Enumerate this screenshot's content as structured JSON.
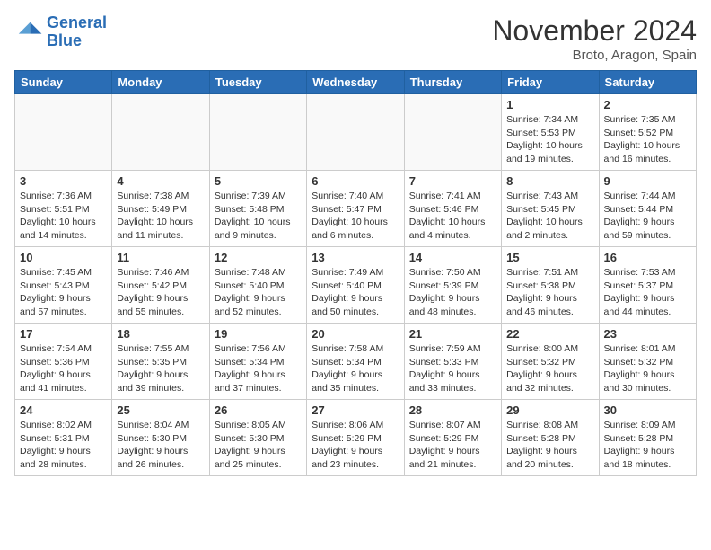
{
  "header": {
    "logo_line1": "General",
    "logo_line2": "Blue",
    "month": "November 2024",
    "location": "Broto, Aragon, Spain"
  },
  "weekdays": [
    "Sunday",
    "Monday",
    "Tuesday",
    "Wednesday",
    "Thursday",
    "Friday",
    "Saturday"
  ],
  "weeks": [
    [
      {
        "day": "",
        "info": ""
      },
      {
        "day": "",
        "info": ""
      },
      {
        "day": "",
        "info": ""
      },
      {
        "day": "",
        "info": ""
      },
      {
        "day": "",
        "info": ""
      },
      {
        "day": "1",
        "info": "Sunrise: 7:34 AM\nSunset: 5:53 PM\nDaylight: 10 hours\nand 19 minutes."
      },
      {
        "day": "2",
        "info": "Sunrise: 7:35 AM\nSunset: 5:52 PM\nDaylight: 10 hours\nand 16 minutes."
      }
    ],
    [
      {
        "day": "3",
        "info": "Sunrise: 7:36 AM\nSunset: 5:51 PM\nDaylight: 10 hours\nand 14 minutes."
      },
      {
        "day": "4",
        "info": "Sunrise: 7:38 AM\nSunset: 5:49 PM\nDaylight: 10 hours\nand 11 minutes."
      },
      {
        "day": "5",
        "info": "Sunrise: 7:39 AM\nSunset: 5:48 PM\nDaylight: 10 hours\nand 9 minutes."
      },
      {
        "day": "6",
        "info": "Sunrise: 7:40 AM\nSunset: 5:47 PM\nDaylight: 10 hours\nand 6 minutes."
      },
      {
        "day": "7",
        "info": "Sunrise: 7:41 AM\nSunset: 5:46 PM\nDaylight: 10 hours\nand 4 minutes."
      },
      {
        "day": "8",
        "info": "Sunrise: 7:43 AM\nSunset: 5:45 PM\nDaylight: 10 hours\nand 2 minutes."
      },
      {
        "day": "9",
        "info": "Sunrise: 7:44 AM\nSunset: 5:44 PM\nDaylight: 9 hours\nand 59 minutes."
      }
    ],
    [
      {
        "day": "10",
        "info": "Sunrise: 7:45 AM\nSunset: 5:43 PM\nDaylight: 9 hours\nand 57 minutes."
      },
      {
        "day": "11",
        "info": "Sunrise: 7:46 AM\nSunset: 5:42 PM\nDaylight: 9 hours\nand 55 minutes."
      },
      {
        "day": "12",
        "info": "Sunrise: 7:48 AM\nSunset: 5:40 PM\nDaylight: 9 hours\nand 52 minutes."
      },
      {
        "day": "13",
        "info": "Sunrise: 7:49 AM\nSunset: 5:40 PM\nDaylight: 9 hours\nand 50 minutes."
      },
      {
        "day": "14",
        "info": "Sunrise: 7:50 AM\nSunset: 5:39 PM\nDaylight: 9 hours\nand 48 minutes."
      },
      {
        "day": "15",
        "info": "Sunrise: 7:51 AM\nSunset: 5:38 PM\nDaylight: 9 hours\nand 46 minutes."
      },
      {
        "day": "16",
        "info": "Sunrise: 7:53 AM\nSunset: 5:37 PM\nDaylight: 9 hours\nand 44 minutes."
      }
    ],
    [
      {
        "day": "17",
        "info": "Sunrise: 7:54 AM\nSunset: 5:36 PM\nDaylight: 9 hours\nand 41 minutes."
      },
      {
        "day": "18",
        "info": "Sunrise: 7:55 AM\nSunset: 5:35 PM\nDaylight: 9 hours\nand 39 minutes."
      },
      {
        "day": "19",
        "info": "Sunrise: 7:56 AM\nSunset: 5:34 PM\nDaylight: 9 hours\nand 37 minutes."
      },
      {
        "day": "20",
        "info": "Sunrise: 7:58 AM\nSunset: 5:34 PM\nDaylight: 9 hours\nand 35 minutes."
      },
      {
        "day": "21",
        "info": "Sunrise: 7:59 AM\nSunset: 5:33 PM\nDaylight: 9 hours\nand 33 minutes."
      },
      {
        "day": "22",
        "info": "Sunrise: 8:00 AM\nSunset: 5:32 PM\nDaylight: 9 hours\nand 32 minutes."
      },
      {
        "day": "23",
        "info": "Sunrise: 8:01 AM\nSunset: 5:32 PM\nDaylight: 9 hours\nand 30 minutes."
      }
    ],
    [
      {
        "day": "24",
        "info": "Sunrise: 8:02 AM\nSunset: 5:31 PM\nDaylight: 9 hours\nand 28 minutes."
      },
      {
        "day": "25",
        "info": "Sunrise: 8:04 AM\nSunset: 5:30 PM\nDaylight: 9 hours\nand 26 minutes."
      },
      {
        "day": "26",
        "info": "Sunrise: 8:05 AM\nSunset: 5:30 PM\nDaylight: 9 hours\nand 25 minutes."
      },
      {
        "day": "27",
        "info": "Sunrise: 8:06 AM\nSunset: 5:29 PM\nDaylight: 9 hours\nand 23 minutes."
      },
      {
        "day": "28",
        "info": "Sunrise: 8:07 AM\nSunset: 5:29 PM\nDaylight: 9 hours\nand 21 minutes."
      },
      {
        "day": "29",
        "info": "Sunrise: 8:08 AM\nSunset: 5:28 PM\nDaylight: 9 hours\nand 20 minutes."
      },
      {
        "day": "30",
        "info": "Sunrise: 8:09 AM\nSunset: 5:28 PM\nDaylight: 9 hours\nand 18 minutes."
      }
    ]
  ]
}
